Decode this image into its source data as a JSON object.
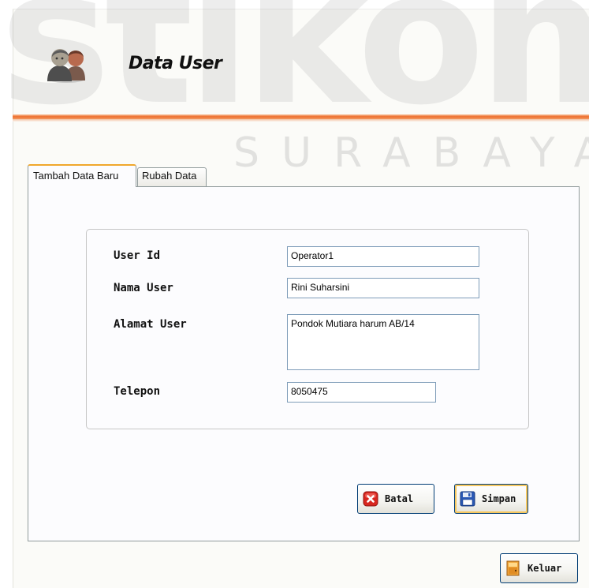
{
  "watermark": {
    "logo_text": "stikom",
    "subtitle": "SURABAYA"
  },
  "header": {
    "title": "Data User",
    "icon": "users-icon",
    "accent_color": "#ee6f2d"
  },
  "tabs": [
    {
      "label": "Tambah Data Baru",
      "active": true
    },
    {
      "label": "Rubah Data",
      "active": false
    }
  ],
  "form": {
    "user_id": {
      "label": "User Id",
      "value": "Operator1"
    },
    "nama_user": {
      "label": "Nama User",
      "value": "Rini Suharsini"
    },
    "alamat_user": {
      "label": "Alamat User",
      "value": "Pondok Mutiara harum AB/14"
    },
    "telepon": {
      "label": "Telepon",
      "value": "8050475"
    }
  },
  "buttons": {
    "batal": {
      "label": "Batal",
      "icon": "cancel-icon"
    },
    "simpan": {
      "label": "Simpan",
      "icon": "save-icon"
    },
    "keluar": {
      "label": "Keluar",
      "icon": "exit-door-icon"
    }
  }
}
